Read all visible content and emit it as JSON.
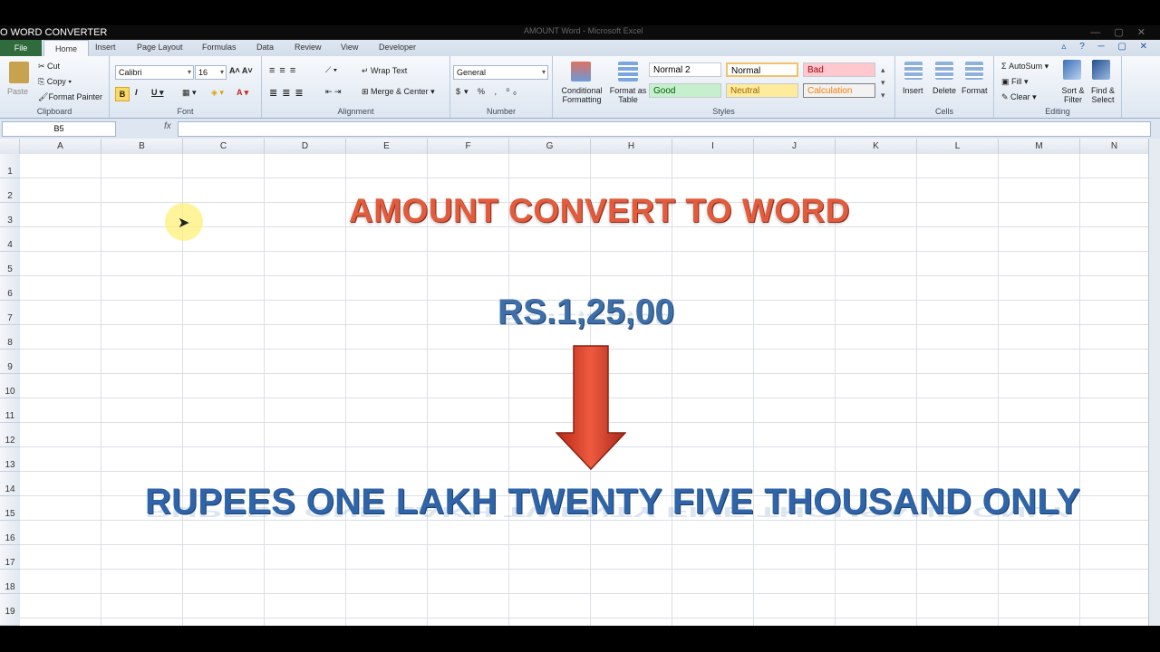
{
  "window": {
    "title_left": "O WORD CONVERTER",
    "title_center": "AMOUNT Word - Microsoft Excel"
  },
  "tabs": [
    "File",
    "Home",
    "Insert",
    "Page Layout",
    "Formulas",
    "Data",
    "Review",
    "View",
    "Developer"
  ],
  "ribbon": {
    "clipboard": {
      "label": "Clipboard",
      "paste": "Paste",
      "cut": "Cut",
      "copy": "Copy",
      "format_painter": "Format Painter"
    },
    "font": {
      "label": "Font",
      "name": "Calibri",
      "size": "16"
    },
    "alignment": {
      "label": "Alignment",
      "wrap": "Wrap Text",
      "merge": "Merge & Center"
    },
    "number": {
      "label": "Number",
      "format": "General"
    },
    "styles": {
      "label": "Styles",
      "conditional": "Conditional Formatting",
      "format_table": "Format as Table",
      "normal2": "Normal 2",
      "normal": "Normal",
      "bad": "Bad",
      "good": "Good",
      "neutral": "Neutral",
      "calculation": "Calculation"
    },
    "cells": {
      "label": "Cells",
      "insert": "Insert",
      "delete": "Delete",
      "format": "Format"
    },
    "editing": {
      "label": "Editing",
      "autosum": "AutoSum",
      "fill": "Fill",
      "clear": "Clear",
      "sort": "Sort & Filter",
      "find": "Find & Select"
    }
  },
  "formula_bar": {
    "name_box": "B5",
    "fx": "fx"
  },
  "columns": [
    "A",
    "B",
    "C",
    "D",
    "E",
    "F",
    "G",
    "H",
    "I",
    "J",
    "K",
    "L",
    "M",
    "N"
  ],
  "rows": [
    "1",
    "2",
    "3",
    "4",
    "5",
    "6",
    "7",
    "8",
    "9",
    "10",
    "11",
    "12",
    "13",
    "14",
    "15",
    "16",
    "17",
    "18",
    "19"
  ],
  "content": {
    "heading": "AMOUNT CONVERT TO WORD",
    "amount": "RS.1,25,00",
    "result": "RUPEES ONE LAKH TWENTY FIVE THOUSAND ONLY"
  },
  "colors": {
    "heading": "#e25b3c",
    "amount": "#3f6fa8",
    "result": "#2f65a8",
    "arrow": "#d9432a",
    "file_tab": "#2f6b3d"
  }
}
